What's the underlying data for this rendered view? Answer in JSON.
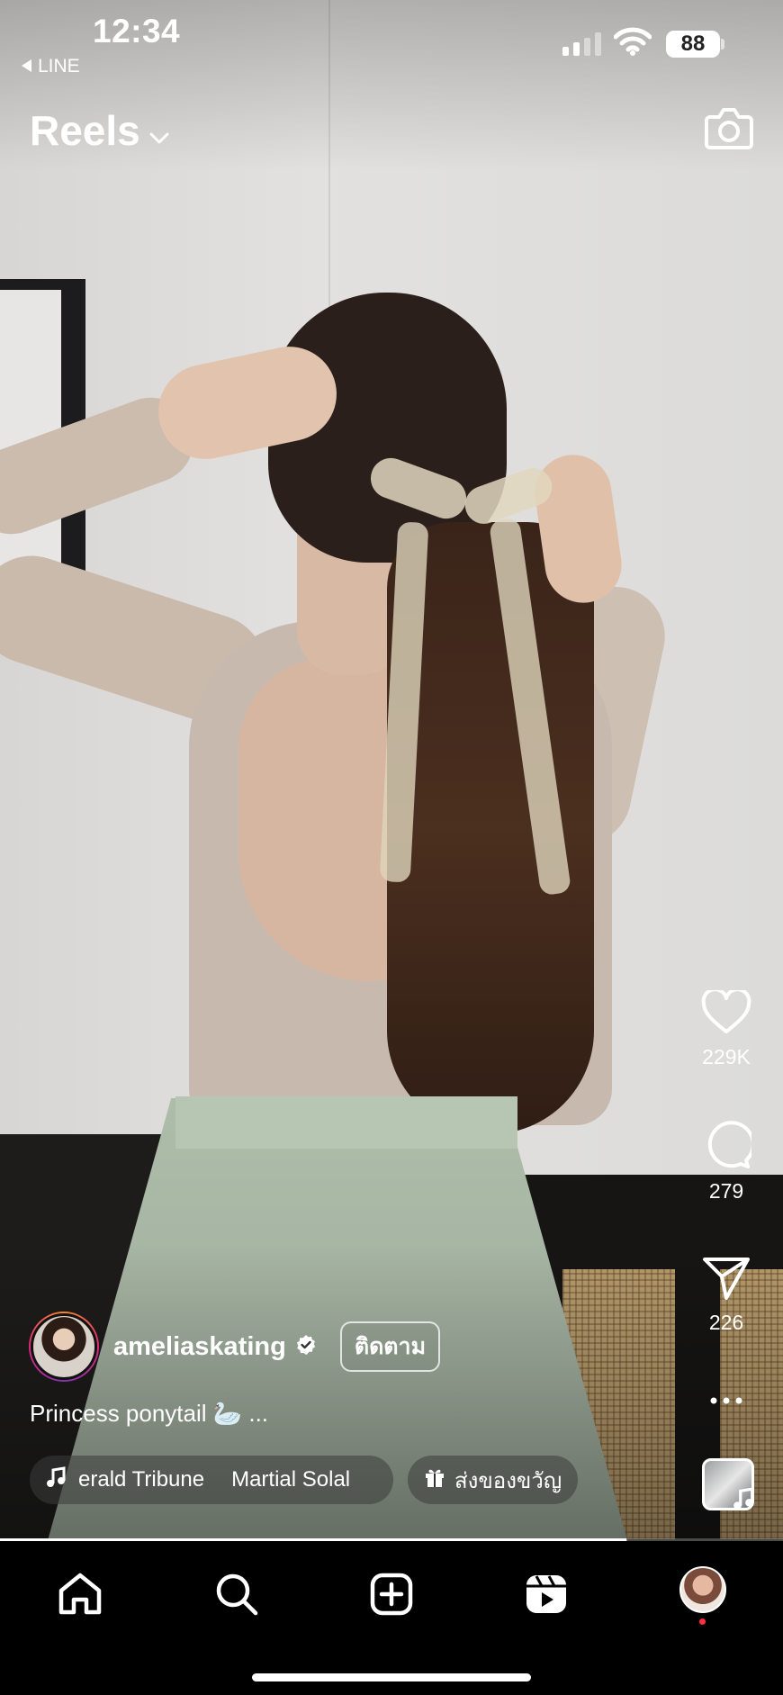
{
  "status_bar": {
    "time": "12:34",
    "back_app": "LINE",
    "battery": "88"
  },
  "header": {
    "title": "Reels",
    "title_icon": "chevron-down-icon",
    "camera_icon": "camera-icon"
  },
  "actions": {
    "likes": "229K",
    "comments": "279",
    "shares": "226",
    "more_icon": "more-horizontal-icon"
  },
  "post": {
    "username": "ameliaskating",
    "verified": true,
    "follow_label": "ติดตาม",
    "caption": "Princess ponytail 🦢 ...",
    "music_track": "erald Tribune",
    "music_artist": "Martial Solal",
    "gift_label": "ส่งของขวัญ"
  },
  "playback": {
    "progress": 0.8
  },
  "bottom_nav": {
    "items": [
      "home-icon",
      "search-icon",
      "create-icon",
      "reels-icon",
      "profile-avatar"
    ],
    "active": "reels-icon"
  },
  "colors": {
    "accent_ring": "#dd2a7b",
    "notification_dot": "#ff3040"
  }
}
